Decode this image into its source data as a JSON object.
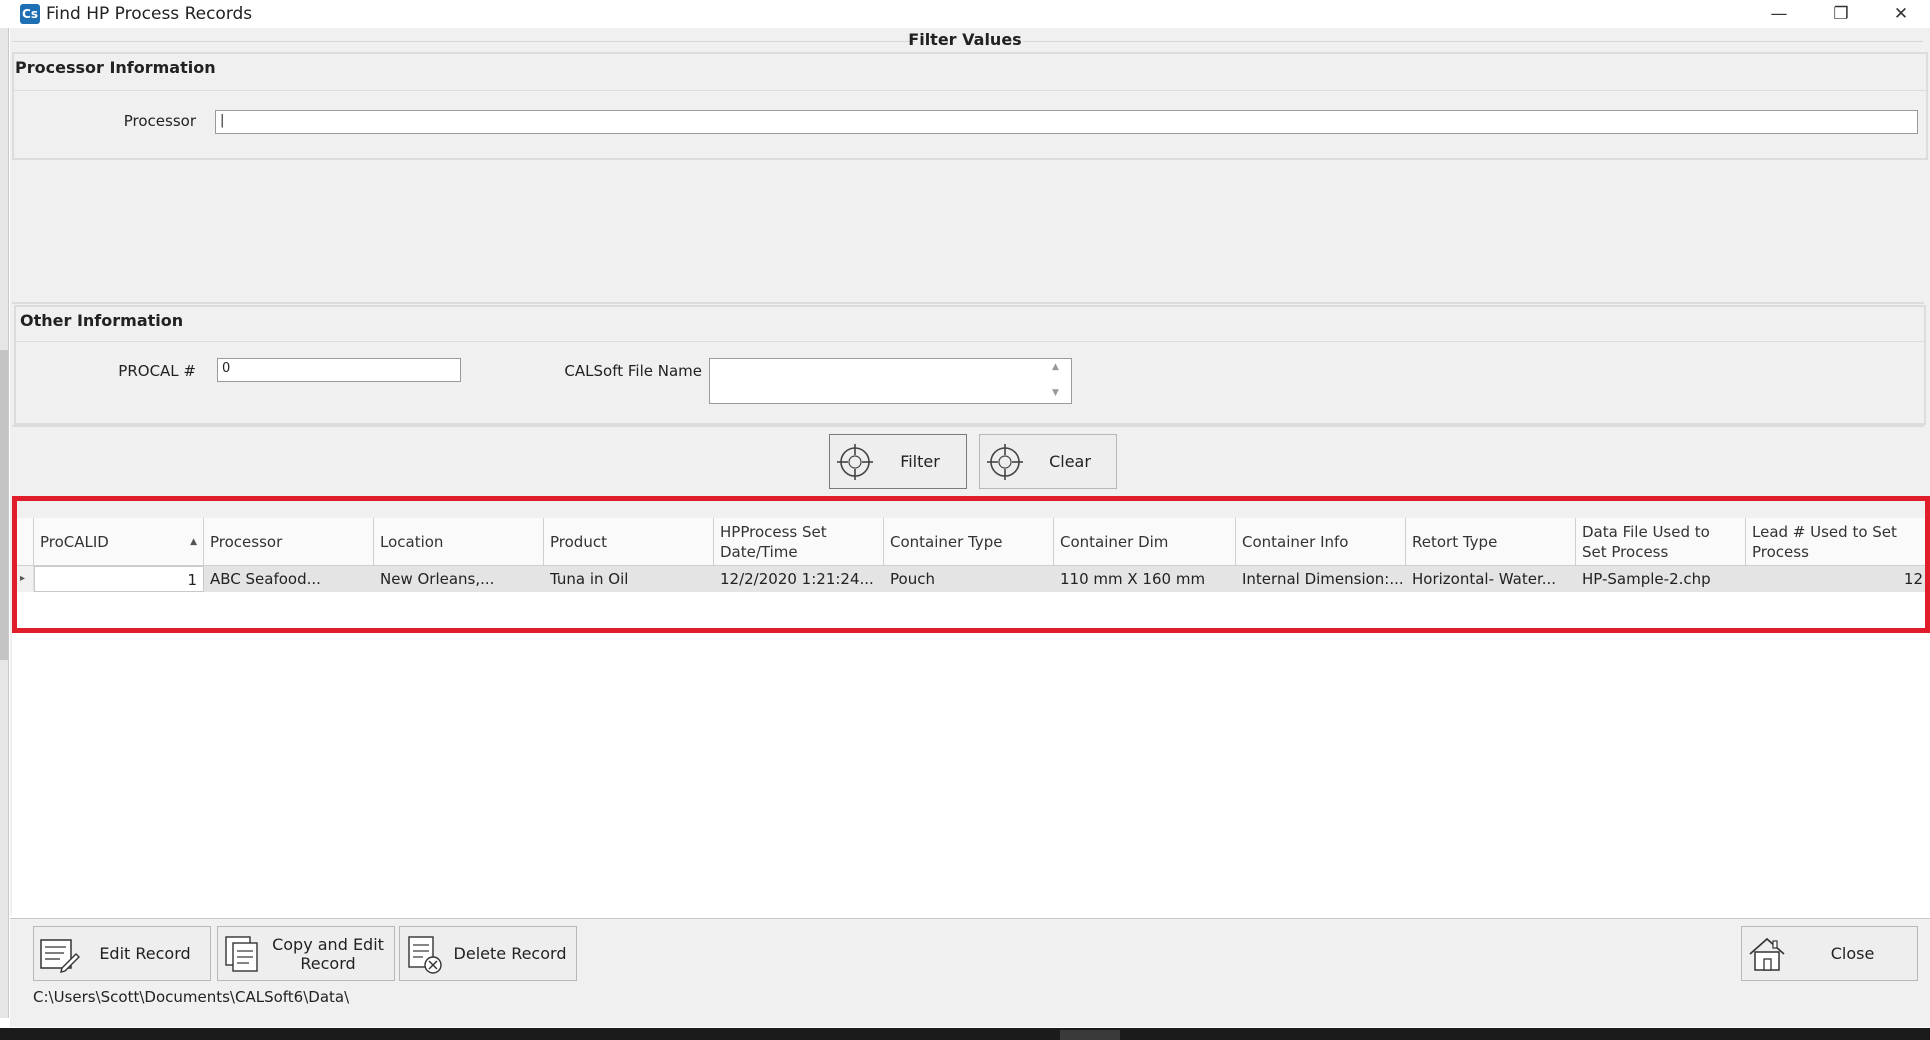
{
  "window": {
    "title": "Find HP Process Records",
    "app_icon_text": "Cs",
    "minimize_glyph": "—",
    "restore_glyph": "❐",
    "close_glyph": "✕"
  },
  "filter": {
    "legend": "Filter Values",
    "processor_group": {
      "title": "Processor Information",
      "processor_label": "Processor",
      "processor_value": "|"
    },
    "other_group": {
      "title": "Other Information",
      "procal_label": "PROCAL #",
      "procal_value": "0",
      "calsoft_label": "CALSoft File Name",
      "calsoft_value": "",
      "scroll_up": "▲",
      "scroll_down": "▼"
    },
    "filter_button": "Filter",
    "clear_button": "Clear"
  },
  "grid": {
    "sort_indicator": "▲",
    "row_indicator": "▸",
    "columns": [
      "ProCALID",
      "Processor",
      "Location",
      "Product",
      "HPProcess Set Date/Time",
      "Container Type",
      "Container Dim",
      "Container Info",
      "Retort Type",
      "Data File Used to Set Process",
      "Lead # Used to Set Process"
    ],
    "rows": [
      {
        "ProCALID": "1",
        "Processor": "ABC Seafood...",
        "Location": "New Orleans,...",
        "Product": "Tuna in Oil",
        "DateTime": "12/2/2020 1:21:24...",
        "ContainerType": "Pouch",
        "ContainerDim": "110 mm X 160 mm",
        "ContainerInfo": "Internal Dimension:...",
        "RetortType": "Horizontal- Water...",
        "DataFile": "HP-Sample-2.chp",
        "Lead": "12"
      }
    ]
  },
  "actions": {
    "edit": "Edit Record",
    "copy_edit": "Copy and Edit Record",
    "delete": "Delete Record",
    "close": "Close"
  },
  "status": {
    "path": "C:\\Users\\Scott\\Documents\\CALSoft6\\Data\\"
  },
  "colors": {
    "highlight": "#e01e2b",
    "panel": "#f0f0f0",
    "app_icon": "#1f6fb5"
  }
}
